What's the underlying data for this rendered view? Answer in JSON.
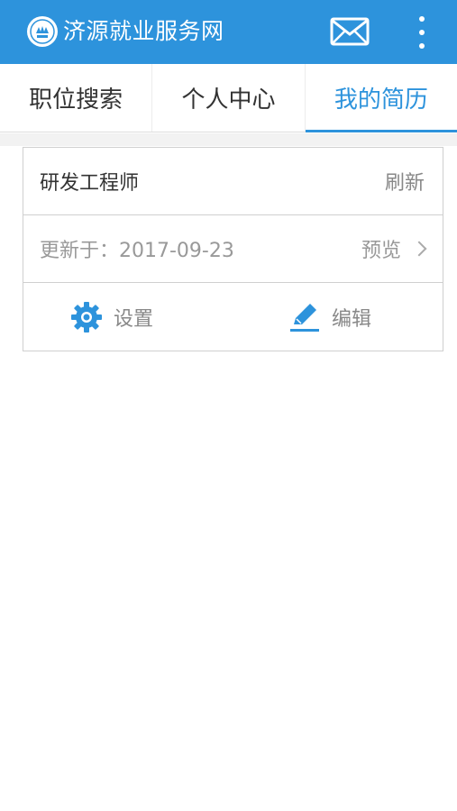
{
  "header": {
    "title": "济源就业服务网",
    "logo_icon": "seal-logo-icon",
    "mail_icon": "envelope-icon",
    "more_icon": "vertical-dots-icon",
    "bg_color": "#2d93dc"
  },
  "tabs": [
    {
      "label": "职位搜索",
      "active": false
    },
    {
      "label": "个人中心",
      "active": false
    },
    {
      "label": "我的简历",
      "active": true
    }
  ],
  "resume": {
    "name": "研发工程师",
    "refresh_label": "刷新",
    "updated_label": "更新于：2017-09-23",
    "preview_label": "预览",
    "actions": {
      "settings_label": "设置",
      "edit_label": "编辑"
    }
  },
  "accent_color": "#2d93dc"
}
